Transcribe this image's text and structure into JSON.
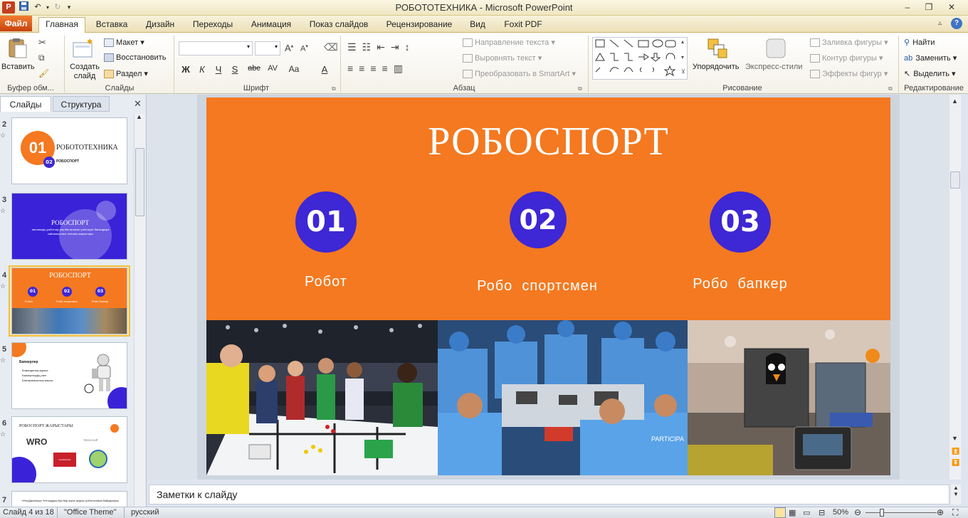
{
  "window": {
    "title": "РОБОТОТЕХНИКА  -  Microsoft PowerPoint",
    "controls": [
      "–",
      "❐",
      "✕"
    ]
  },
  "ribbon_tabs": {
    "file": "Файл",
    "items": [
      "Главная",
      "Вставка",
      "Дизайн",
      "Переходы",
      "Анимация",
      "Показ слайдов",
      "Рецензирование",
      "Вид",
      "Foxit PDF"
    ]
  },
  "ribbon": {
    "clipboard": {
      "paste": "Вставить",
      "group": "Буфер обм..."
    },
    "slides": {
      "new_slide": "Создать слайд",
      "layout": "Макет",
      "reset": "Восстановить",
      "section": "Раздел",
      "group": "Слайды"
    },
    "font": {
      "group": "Шрифт",
      "buttons": [
        "Ж",
        "К",
        "Ч",
        "S",
        "abc",
        "AV",
        "Aa",
        "A"
      ]
    },
    "paragraph": {
      "text_direction": "Направление текста",
      "align_text": "Выровнять текст",
      "smartart": "Преобразовать в SmartArt",
      "group": "Абзац"
    },
    "drawing": {
      "arrange": "Упорядочить",
      "quick_styles": "Экспресс-стили",
      "fill": "Заливка фигуры",
      "outline": "Контур фигуры",
      "effects": "Эффекты фигур",
      "group": "Рисование"
    },
    "editing": {
      "find": "Найти",
      "replace": "Заменить",
      "select": "Выделить",
      "group": "Редактирование"
    }
  },
  "panel_tabs": {
    "slides": "Слайды",
    "outline": "Структура"
  },
  "thumbnails": [
    {
      "num": "2",
      "title": "РОБОТОТЕХНИКА",
      "badge1": "01",
      "badge2": "02",
      "sub": "РОБОСПОРТ"
    },
    {
      "num": "3",
      "title": "РОБОСПОРТ",
      "sub": "автокөлдің роботтар уақ басталатын үлестерін бағындыра сайланыстағы техника жарыстары"
    },
    {
      "num": "4",
      "title": "РОБОСПОРТ",
      "badges": [
        "01",
        "02",
        "03"
      ],
      "labels": [
        "Робот",
        "Робо спортсмен",
        "Робо банкер"
      ]
    },
    {
      "num": "5",
      "title": "Бапкерлер",
      "bullets": [
        "Командалық жұмыс",
        "Бапкерлердің рөлі",
        "Шығармашылық жарыс"
      ]
    },
    {
      "num": "6",
      "title": "РОБОСПОРТ ЖАРЫСТАРЫ",
      "logos": [
        "WRO",
        "TECH CUP",
        "KazRobotics"
      ]
    },
    {
      "num": "7",
      "sub": "«ҰлыДаланың» Ұлттардың бірі бар және жарыс роботехника байқаулары"
    }
  ],
  "slide": {
    "title": "РОБОСПОРТ",
    "circles": [
      "01",
      "02",
      "03"
    ],
    "labels": [
      "Робот",
      "Робо  спортсмен",
      "Робо  бапкер"
    ],
    "photos": [
      "competition-arena-photo",
      "team-building-robots-photo",
      "robot-closeup-photo"
    ],
    "accent_color": "#f47920",
    "circle_color": "#3e27d4"
  },
  "notes": {
    "placeholder": "Заметки к слайду"
  },
  "status": {
    "slide_info": "Слайд 4 из 18",
    "theme": "\"Office Theme\"",
    "language": "русский",
    "zoom": "50%"
  }
}
